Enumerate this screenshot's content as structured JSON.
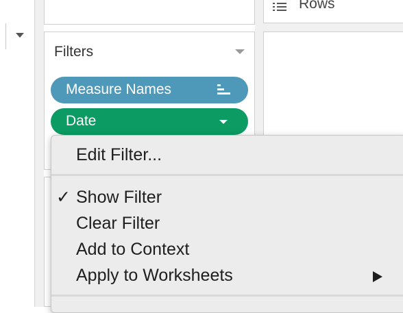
{
  "shelves": {
    "rows_label": "Rows"
  },
  "filters": {
    "title": "Filters",
    "pills": [
      {
        "label": "Measure Names",
        "color": "#4e99b9",
        "icon": "sort-icon"
      },
      {
        "label": "Date",
        "color": "#0b9b63",
        "icon": "chevron-down-icon"
      }
    ]
  },
  "context_menu": {
    "items": [
      {
        "label": "Edit Filter...",
        "checked": false
      },
      {
        "label": "Show Filter",
        "checked": true,
        "check_glyph": "✓"
      },
      {
        "label": "Clear Filter",
        "checked": false
      },
      {
        "label": "Add to Context",
        "checked": false
      },
      {
        "label": "Apply to Worksheets",
        "checked": false,
        "has_submenu": true
      }
    ]
  }
}
